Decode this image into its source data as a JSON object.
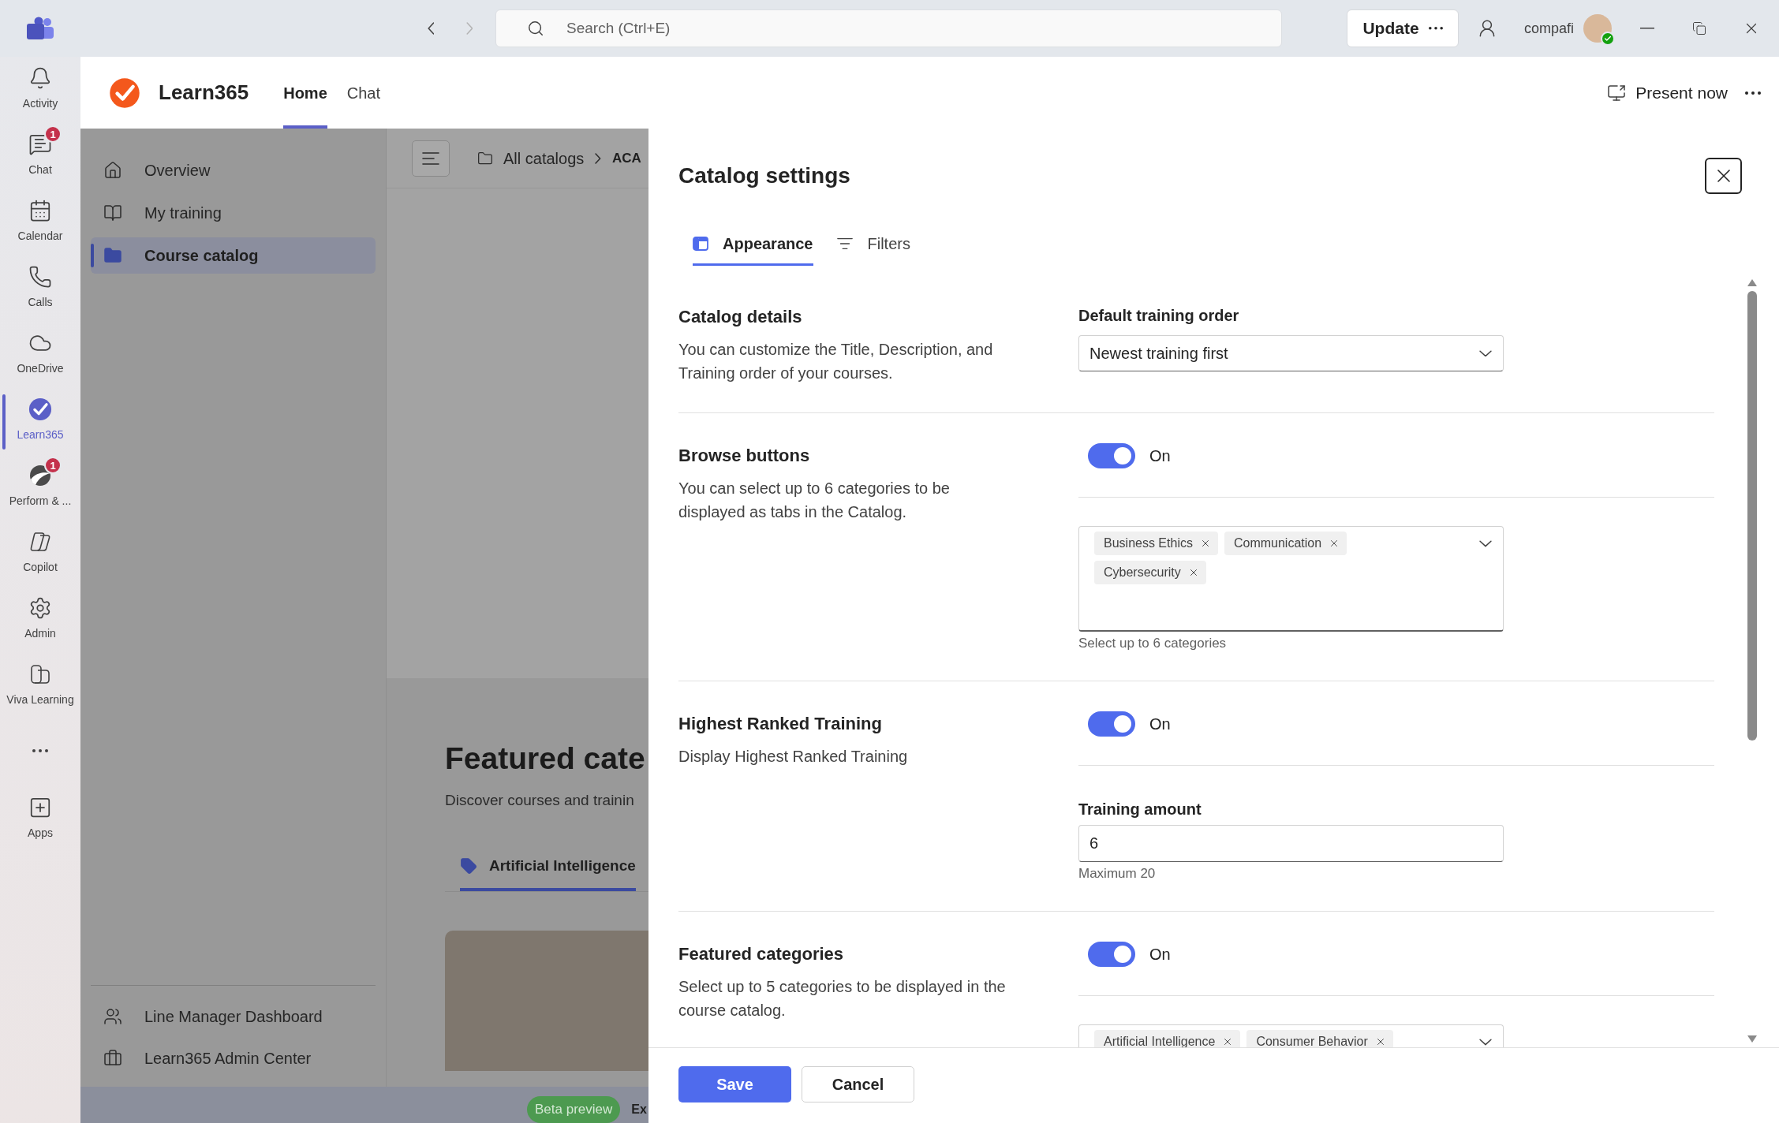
{
  "title_bar": {
    "search": {
      "placeholder": "Search (Ctrl+E)"
    },
    "update_button": {
      "label": "Update"
    },
    "user_name": "compafi"
  },
  "app_rail": {
    "items": [
      {
        "label": "Activity",
        "selected": false
      },
      {
        "label": "Chat",
        "selected": false,
        "badge": "1"
      },
      {
        "label": "Calendar",
        "selected": false
      },
      {
        "label": "Calls",
        "selected": false
      },
      {
        "label": "OneDrive",
        "selected": false
      },
      {
        "label": "Learn365",
        "selected": true
      },
      {
        "label": "Perform & ...",
        "selected": false,
        "badge": "1"
      },
      {
        "label": "Copilot",
        "selected": false
      },
      {
        "label": "Admin",
        "selected": false
      },
      {
        "label": "Viva Learning",
        "selected": false
      }
    ],
    "apps_button": {
      "label": "Apps"
    }
  },
  "app_header": {
    "app_name": "Learn365",
    "tabs": [
      {
        "label": "Home",
        "selected": true
      },
      {
        "label": "Chat",
        "selected": false
      }
    ],
    "present_button": {
      "label": "Present now"
    }
  },
  "side_nav": {
    "items": [
      {
        "label": "Overview",
        "selected": false
      },
      {
        "label": "My training",
        "selected": false
      },
      {
        "label": "Course catalog",
        "selected": true
      }
    ],
    "footer_items": [
      {
        "label": "Line Manager Dashboard"
      },
      {
        "label": "Learn365 Admin Center"
      }
    ]
  },
  "catalog_page": {
    "breadcrumb": [
      {
        "label": "All catalogs"
      },
      {
        "label": "ACA"
      }
    ],
    "heading": "Featured cate",
    "subheading": "Discover courses and trainin",
    "category_tabs": [
      {
        "label": "Artificial Intelligence",
        "selected": true
      }
    ],
    "status_badge": "Beta preview",
    "footer_text": "Ex"
  },
  "dialog": {
    "title": "Catalog settings",
    "tabs": [
      {
        "label": "Appearance",
        "selected": true
      },
      {
        "label": "Filters",
        "selected": false
      }
    ],
    "sections": [
      {
        "kind": "select",
        "title": "Catalog details",
        "description": "You can customize the Title, Description, and Training order of your courses.",
        "field": {
          "label": "Default training order",
          "value": "Newest training first"
        }
      },
      {
        "kind": "toggle_tags",
        "title": "Browse buttons",
        "description": "You can select up to 6 categories to be displayed as tabs in the Catalog.",
        "toggle": {
          "on": true,
          "label": "On"
        },
        "tags": [
          "Business Ethics",
          "Communication",
          "Cybersecurity"
        ],
        "hint": "Select up to 6 categories"
      },
      {
        "kind": "toggle_number",
        "title": "Highest Ranked Training",
        "description": "Display Highest Ranked Training",
        "toggle": {
          "on": true,
          "label": "On"
        },
        "field": {
          "label": "Training amount",
          "value": "6"
        },
        "hint": "Maximum 20"
      },
      {
        "kind": "toggle_tags",
        "title": "Featured categories",
        "description": "Select up to 5 categories to be displayed in the course catalog.",
        "toggle": {
          "on": true,
          "label": "On"
        },
        "tags": [
          "Artificial Intelligence",
          "Consumer Behavior"
        ]
      }
    ],
    "buttons": [
      {
        "label": "Save",
        "kind": "primary"
      },
      {
        "label": "Cancel",
        "kind": "secondary"
      }
    ]
  }
}
